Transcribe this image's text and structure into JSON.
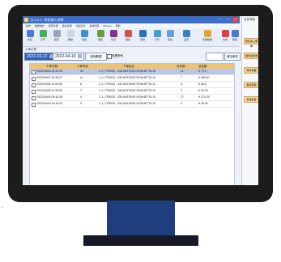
{
  "window": {
    "title": "Q 0.0.1 · 供应商入库单",
    "controls": [
      "─",
      "□",
      "×"
    ]
  },
  "menu": [
    "操作",
    "数据维护",
    "经营管理",
    "报表管理",
    "应收应付",
    "系统管理",
    "Window",
    "帮助"
  ],
  "toolbar": [
    {
      "label": "新建",
      "color": "#4b7bd4"
    },
    {
      "label": "打开",
      "color": "#3fae5d"
    },
    {
      "label": "保存",
      "color": "#9aa6b8"
    },
    {
      "label": "删除",
      "color": "#d0d6e0"
    },
    {
      "label": "增加",
      "color": "#3f8fd0"
    },
    {
      "label": "审核",
      "color": "#6b9a3a"
    },
    {
      "label": "付款",
      "color": "#8b2f8f"
    },
    {
      "label": "刷新",
      "color": "#d65050"
    },
    {
      "label": "查询",
      "color": "#2f6fb6"
    },
    {
      "label": "打印",
      "color": "#3fa0c8"
    },
    {
      "label": "导出",
      "color": "#6aa0d8"
    },
    {
      "label": "设置",
      "color": "#3a80c8"
    },
    {
      "label": "复制数据",
      "color": "#e3a33a"
    },
    {
      "label": "关闭",
      "color": "#d94242"
    },
    {
      "label": "帮助",
      "color": "#4a7ad0"
    }
  ],
  "section_label": "入库记录",
  "filter": {
    "date_from": "2022-03-22",
    "date_to": "2022-04-19",
    "search_button": "查询数据",
    "checkbox_label": "查看所有",
    "clear_button": "清空条件"
  },
  "table": {
    "headers": [
      "下单日期",
      "下单号码",
      "下单品名",
      "总件数",
      "总金额"
    ],
    "rows": [
      {
        "date": "2022/04/08 15:22:28",
        "no": "32",
        "name": "1-1 | TF8033 - 430 ANTONIO ROAHETTA 13",
        "qty": "11",
        "amount": "¥ 79.5",
        "selected": true
      },
      {
        "date": "2022/04/07 15:28:37",
        "no": "rrf",
        "name": "1-1 | TF8033 - 430 ANTONIO ROAHETTA 13",
        "qty": "7",
        "amount": "¥ 289.00",
        "selected": false
      },
      {
        "date": "2022/04/06 11:09:30",
        "no": "8",
        "name": "1-1 | TF8033 - 430 ANTONIO ROAHETTA 13",
        "qty": "6",
        "amount": "¥ 46.5",
        "selected": false
      },
      {
        "date": "2022/04/05 11:35:06",
        "no": "7",
        "name": "1-1 | TF8033 - 430 ANTONIO ROAHETTA 13",
        "qty": "4",
        "amount": "¥ 46.00",
        "selected": false
      },
      {
        "date": "2022/04/04 09:42:26",
        "no": "4",
        "name": "1-1 | TF8033 - 430 ANTONIO ROAHETTA 13",
        "qty": "17",
        "amount": "¥ 274.23",
        "selected": false
      },
      {
        "date": "2022/04/03 16:16:24",
        "no": "3",
        "name": "1-1 | TF8033 - 430 ANTONIO ROAHETTA 13",
        "qty": "4",
        "amount": "¥ 38.00",
        "selected": false
      }
    ]
  },
  "right_panel": {
    "title": "业务导航",
    "items": [
      "供应商入库单",
      "销售出库单",
      "库存管理",
      "报表查询",
      "系统设置"
    ]
  }
}
